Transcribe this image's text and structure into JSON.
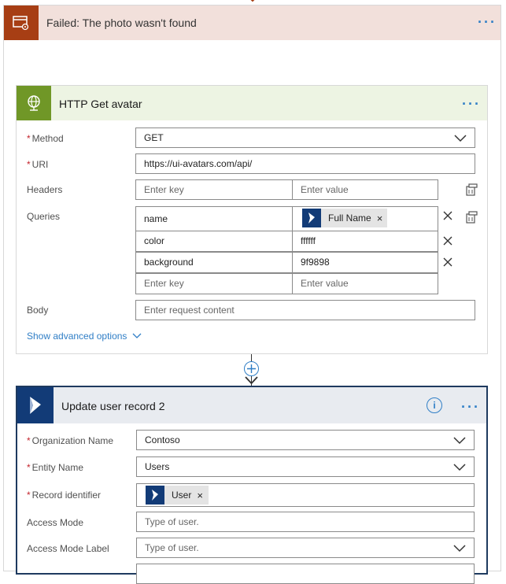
{
  "scope": {
    "title": "Failed: The photo wasn't found",
    "menu_icon": "more-dots-icon",
    "accent": "#a73e14"
  },
  "http": {
    "title": "HTTP Get avatar",
    "method_label": "Method",
    "method_value": "GET",
    "uri_label": "URI",
    "uri_value": "https://ui-avatars.com/api/",
    "headers_label": "Headers",
    "header_key_placeholder": "Enter key",
    "header_value_placeholder": "Enter value",
    "queries_label": "Queries",
    "queries": [
      {
        "key": "name",
        "value": "",
        "token": "Full Name"
      },
      {
        "key": "color",
        "value": "ffffff"
      },
      {
        "key": "background",
        "value": "9f9898"
      }
    ],
    "query_key_placeholder": "Enter key",
    "query_value_placeholder": "Enter value",
    "body_label": "Body",
    "body_placeholder": "Enter request content",
    "advanced_link": "Show advanced options",
    "accent": "#709727"
  },
  "dynamics": {
    "title": "Update user record 2",
    "org_label": "Organization Name",
    "org_value": "Contoso",
    "entity_label": "Entity Name",
    "entity_value": "Users",
    "record_label": "Record identifier",
    "record_token": "User",
    "access_mode_label": "Access Mode",
    "access_mode_placeholder": "Type of user.",
    "access_mode_label_label": "Access Mode Label",
    "access_mode_label_placeholder": "Type of user.",
    "accent": "#123b77"
  },
  "required_marker": "*",
  "token_remove": "×"
}
